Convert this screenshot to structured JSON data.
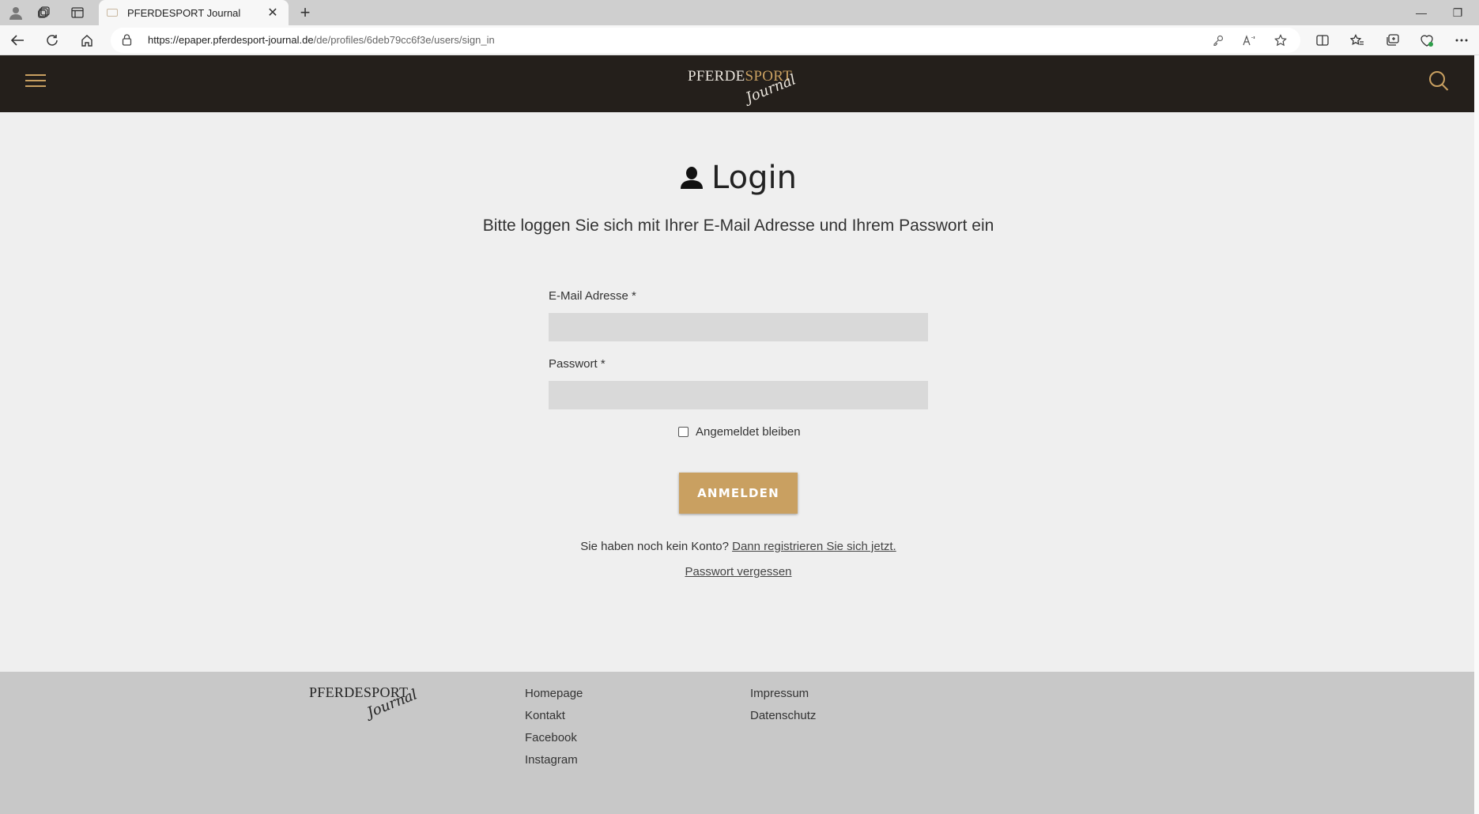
{
  "browser": {
    "tab_title": "PFERDESPORT Journal",
    "tab_close": "✕",
    "new_tab": "+",
    "url_host": "https://epaper.pferdesport-journal.de",
    "url_path": "/de/profiles/6deb79cc6f3e/users/sign_in",
    "window_controls": {
      "minimize": "—",
      "restore": "❐"
    }
  },
  "site": {
    "logo_main_a": "PFERDE",
    "logo_main_b": "SPORT",
    "logo_sub": "Journal",
    "accent_color": "#c9a061",
    "header_color": "#241f1b"
  },
  "login": {
    "title": "Login",
    "subtitle": "Bitte loggen Sie sich mit Ihrer E-Mail Adresse und Ihrem Passwort ein",
    "email_label": "E-Mail Adresse *",
    "email_value": "",
    "password_label": "Passwort *",
    "password_value": "",
    "remember_label": "Angemeldet bleiben",
    "remember_checked": false,
    "submit_label": "ANMELDEN",
    "no_account_text": "Sie haben noch kein Konto?",
    "register_link": "Dann registrieren Sie sich jetzt.",
    "forgot_link": "Passwort vergessen"
  },
  "footer": {
    "col1": [
      "Homepage",
      "Kontakt",
      "Facebook",
      "Instagram"
    ],
    "col2": [
      "Impressum",
      "Datenschutz"
    ]
  }
}
